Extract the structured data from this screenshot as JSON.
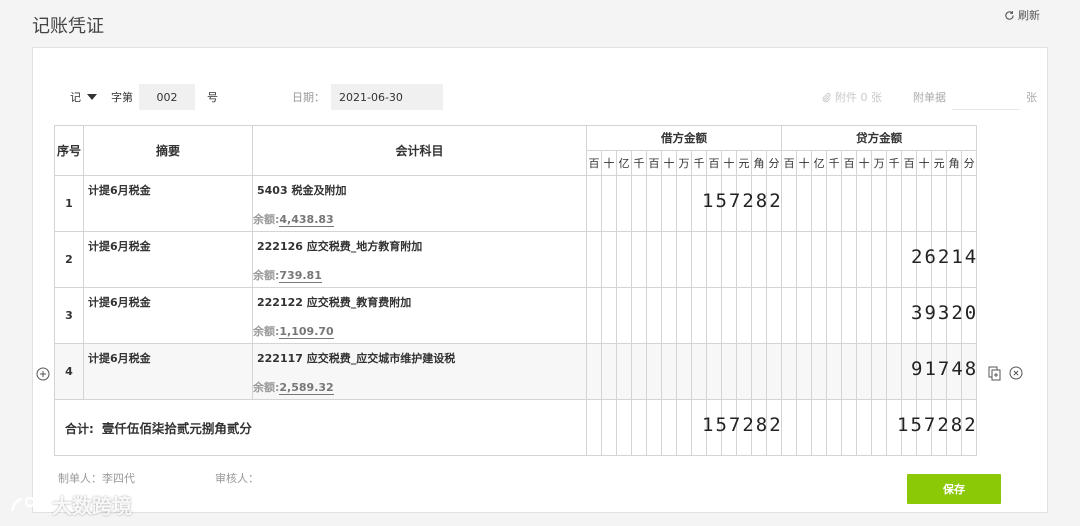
{
  "page": {
    "title": "记账凭证",
    "refresh_label": "刷新"
  },
  "header": {
    "voucher_word": "记",
    "zi_label": "字第",
    "voucher_number": "002",
    "hao_label": "号",
    "date_label": "日期：",
    "date_value": "2021-06-30",
    "attachments_label": "附件 0 张",
    "attached_docs_label": "附单据",
    "attached_docs_value": "",
    "zhang_label": "张"
  },
  "table": {
    "col_seq": "序号",
    "col_summary": "摘要",
    "col_account": "会计科目",
    "col_debit": "借方金额",
    "col_credit": "贷方金额",
    "digit_headers": [
      "百",
      "十",
      "亿",
      "千",
      "百",
      "十",
      "万",
      "千",
      "百",
      "十",
      "元",
      "角",
      "分"
    ],
    "balance_label": "余额:",
    "rows": [
      {
        "seq": "1",
        "summary": "计提6月税金",
        "account": "5403 税金及附加",
        "balance": "4,438.83",
        "debit": "157282",
        "credit": ""
      },
      {
        "seq": "2",
        "summary": "计提6月税金",
        "account": "222126 应交税费_地方教育附加",
        "balance": "739.81",
        "debit": "",
        "credit": "26214"
      },
      {
        "seq": "3",
        "summary": "计提6月税金",
        "account": "222122 应交税费_教育费附加",
        "balance": "1,109.70",
        "debit": "",
        "credit": "39320"
      },
      {
        "seq": "4",
        "summary": "计提6月税金",
        "account": "222117 应交税费_应交城市维护建设税",
        "balance": "2,589.32",
        "debit": "",
        "credit": "91748"
      }
    ],
    "total": {
      "label": "合计:",
      "in_words": "壹仟伍佰柒拾贰元捌角贰分",
      "debit": "157282",
      "credit": "157282"
    }
  },
  "footer": {
    "maker_label": "制单人：李四代",
    "auditor_label": "审核人：",
    "save_label": "保存"
  },
  "watermark": {
    "text": "大数跨境"
  },
  "colors": {
    "save_button": "#8bc805",
    "yuan_separator": "#f0b0b0",
    "thousand_separator": "#a8d4ee"
  }
}
